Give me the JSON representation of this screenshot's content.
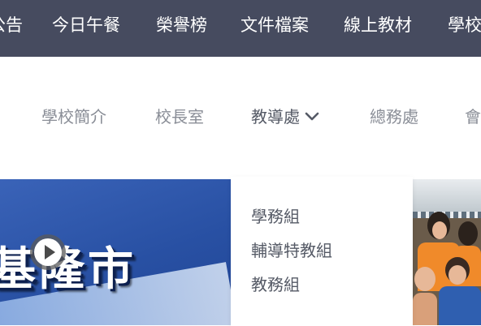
{
  "top_nav": {
    "items": [
      "公告",
      "今日午餐",
      "榮譽榜",
      "文件檔案",
      "線上教材",
      "學校"
    ]
  },
  "sub_nav": {
    "items": [
      "學校簡介",
      "校長室",
      "教導處",
      "總務處",
      "會"
    ],
    "active": "教導處"
  },
  "dropdown": {
    "items": [
      "學務組",
      "輔導特教組",
      "教務組"
    ]
  },
  "hero": {
    "title": "基隆市"
  },
  "colors": {
    "top_nav_bg": "#464b5f",
    "sub_nav_text": "#8a8e97",
    "active_text": "#555a66",
    "hero_blue": "#2850a3"
  }
}
